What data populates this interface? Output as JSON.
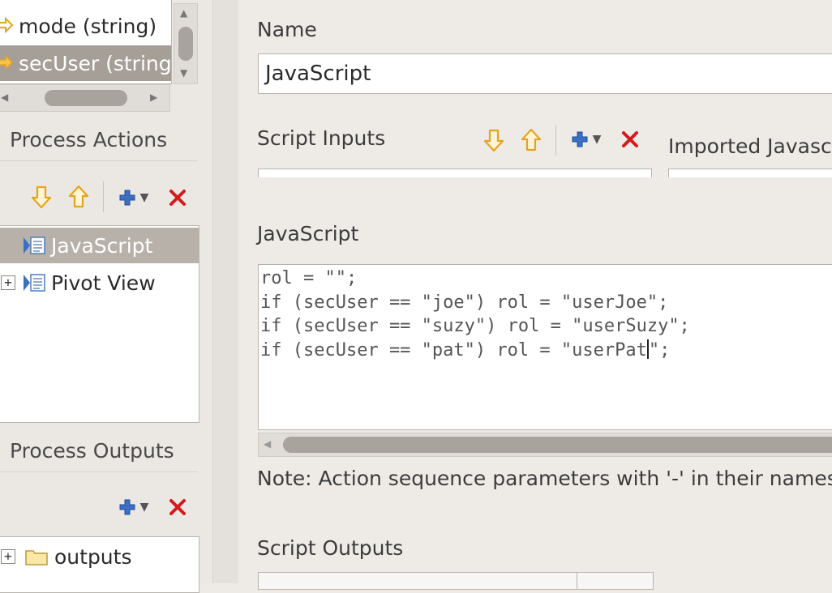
{
  "parameters": {
    "items": [
      {
        "label": "mode (string)",
        "icon": "arrow-right-icon"
      },
      {
        "label": "secUser (string)",
        "icon": "arrow-right-icon"
      }
    ]
  },
  "process_actions": {
    "title": "Process Actions",
    "items": [
      {
        "label": "JavaScript",
        "icon": "script-action-icon",
        "selected": true
      },
      {
        "label": "Pivot View",
        "icon": "script-action-icon",
        "expand": "+"
      }
    ]
  },
  "process_outputs": {
    "title": "Process Outputs",
    "items": [
      {
        "label": "outputs",
        "icon": "folder-icon",
        "expand": "+"
      }
    ]
  },
  "detail": {
    "name_label": "Name",
    "name_value": "JavaScript",
    "script_inputs_label": "Script Inputs",
    "imported_label": "Imported Javascript",
    "javascript_label": "JavaScript",
    "code_lines": [
      "rol = \"\";",
      "if (secUser == \"joe\") rol = \"userJoe\";",
      "if (secUser == \"suzy\") rol = \"userSuzy\";",
      "if (secUser == \"pat\") rol = \"userPat"
    ],
    "code_after_caret": "\";",
    "note": "Note: Action sequence parameters with '-' in their names",
    "script_outputs_label": "Script Outputs"
  },
  "colors": {
    "arrow": "#e8a31c",
    "delete": "#d41a1a",
    "add": "#3a6fc4"
  }
}
